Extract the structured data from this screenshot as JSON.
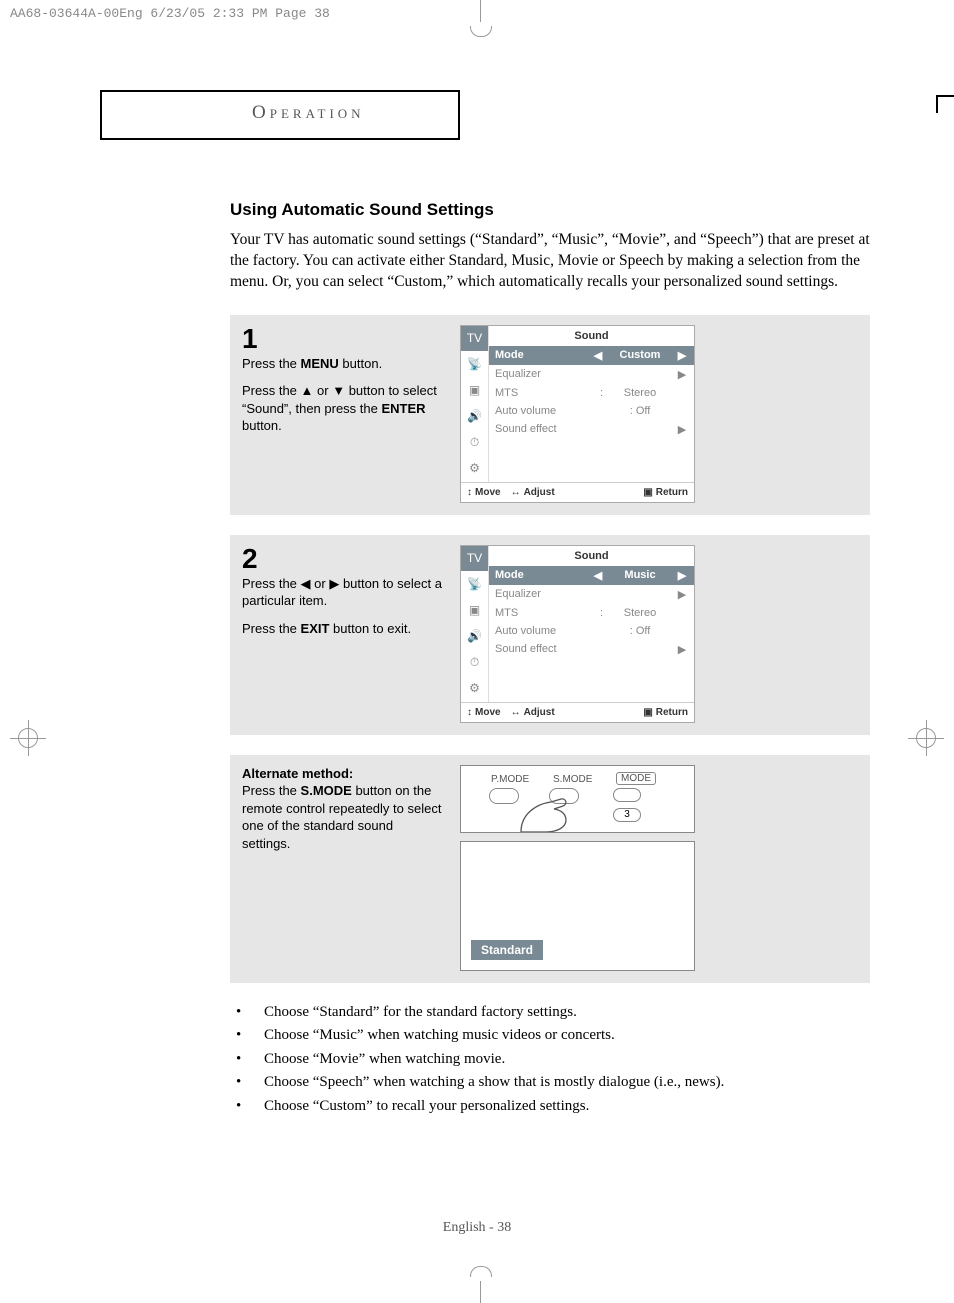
{
  "print_header": "AA68-03644A-00Eng  6/23/05  2:33 PM  Page 38",
  "tab_label": "Operation",
  "section_title": "Using Automatic Sound Settings",
  "intro": "Your TV has automatic sound settings (“Standard”, “Music”, “Movie”, and “Speech”) that are preset at the factory.  You can activate either Standard, Music, Movie or Speech by making a selection from the menu. Or, you can select “Custom,” which automatically recalls your personalized sound settings.",
  "steps": [
    {
      "num": "1",
      "para1_a": "Press the ",
      "para1_b": "MENU",
      "para1_c": " button.",
      "para2_a": "Press the ",
      "up": "▲",
      "or": " or ",
      "down": "▼",
      "para2_b": " button to select “Sound”, then press the ",
      "enter": "ENTER",
      "para2_c": " button."
    },
    {
      "num": "2",
      "para1_a": "Press the ",
      "left": "◀",
      "or": " or ",
      "right": "▶",
      "para1_b": " button to select a particular item.",
      "para2_a": "Press the ",
      "exit": "EXIT",
      "para2_b": " button to exit."
    }
  ],
  "alt_title": "Alternate method:",
  "alt_a": "Press the ",
  "alt_b": "S.MODE",
  "alt_c": " button on the remote control repeatedly to select one of the standard sound settings.",
  "osd": {
    "title": "Sound",
    "side_tv": "TV",
    "rows": {
      "mode": "Mode",
      "equalizer": "Equalizer",
      "mts": "MTS",
      "auto_volume": "Auto volume",
      "sound_effect": "Sound effect"
    },
    "vals1": {
      "mode": "Custom",
      "mts": "Stereo",
      "auto": "Off"
    },
    "vals2": {
      "mode": "Music",
      "mts": "Stereo",
      "auto": "Off"
    },
    "colon": ":",
    "colon_off": ": Off",
    "footer": {
      "move": "Move",
      "adjust": "Adjust",
      "return": "Return"
    },
    "arrows": {
      "l": "◀",
      "r": "▶",
      "ud": "↕",
      "lr": "↔",
      "box": "▣"
    }
  },
  "remote": {
    "pmode": "P.MODE",
    "smode": "S.MODE",
    "mode": "MODE",
    "three": "3"
  },
  "standard_tag": "Standard",
  "bullets": [
    "Choose “Standard” for the standard factory settings.",
    "Choose “Music” when watching music videos or concerts.",
    "Choose “Movie” when watching movie.",
    "Choose “Speech” when watching a show that is mostly dialogue (i.e., news).",
    "Choose “Custom” to recall your personalized settings."
  ],
  "page_footer": "English - 38"
}
